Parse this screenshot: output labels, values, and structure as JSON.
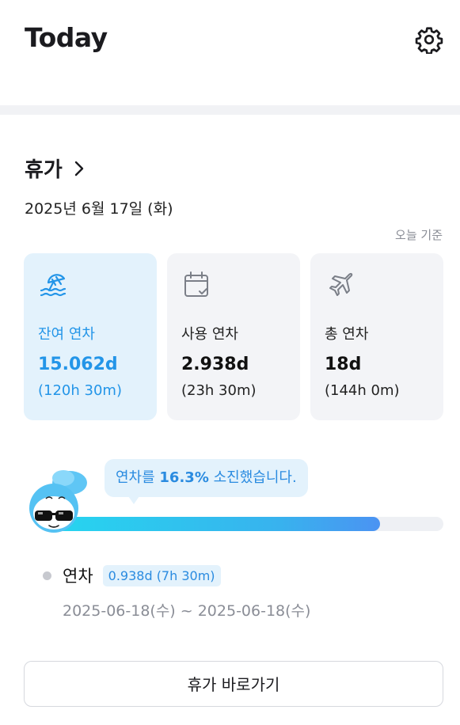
{
  "header": {
    "title": "Today",
    "settings_icon": "gear-icon"
  },
  "vacation": {
    "title": "휴가",
    "date": "2025년 6월 17일 (화)",
    "basis": "오늘 기준",
    "cards": [
      {
        "icon": "beach-umbrella-icon",
        "label": "잔여 연차",
        "days": "15.062d",
        "hours": "(120h 30m)",
        "active": true
      },
      {
        "icon": "calendar-check-icon",
        "label": "사용 연차",
        "days": "2.938d",
        "hours": "(23h 30m)",
        "active": false
      },
      {
        "icon": "airplane-icon",
        "label": "총 연차",
        "days": "18d",
        "hours": "(144h 0m)",
        "active": false
      }
    ],
    "usage": {
      "prefix": "연차를 ",
      "percent_text": "16.3%",
      "suffix": " 소진했습니다.",
      "progress_percent": 84
    },
    "entry": {
      "label": "연차",
      "badge": "0.938d (7h 30m)",
      "range": "2025-06-18(수) ~ 2025-06-18(수)"
    },
    "go_button": "휴가 바로가기"
  },
  "colors": {
    "accent": "#2395e8",
    "card_active_bg": "#e3f2fc",
    "card_bg": "#f3f4f7"
  }
}
